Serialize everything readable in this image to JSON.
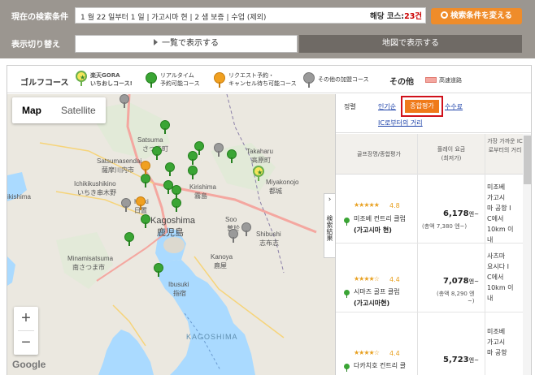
{
  "search": {
    "label": "現在の検索条件",
    "conditions": "1 월 22 일부터 1 일 | 가고시마 현 | 2 샘 보증 | 수업 (제외)",
    "hit_prefix": "해당 코스:",
    "hit_count": "23건",
    "change_button": "検索条件を変える"
  },
  "display": {
    "label": "表示切り替え",
    "list_button": "一覧で表示する",
    "map_button": "地図で表示する"
  },
  "legend": {
    "title": "ゴルフコース",
    "gora": "楽天GORA\nいちおしコース!",
    "realtime": "リアルタイム\n予約可能コース",
    "request": "リクエスト予約・\nキャンセル待ち可能コース",
    "other": "その他の加盟コース",
    "sonota": "その他",
    "highway": "高速道路"
  },
  "map": {
    "type_map": "Map",
    "type_satellite": "Satellite",
    "zoom_in": "+",
    "zoom_out": "−",
    "attribution": "Google",
    "labels": {
      "satsuma": "Satsuma",
      "satsuma_jp": "さつま町",
      "satsumasendai": "Satsumasendai",
      "satsumasendai_jp": "薩摩川内市",
      "ichikikushikino": "Ichikikushikino",
      "ichikikushikino_jp": "いちき串木野",
      "hioki": "Hioki",
      "hioki_jp": "日置",
      "kagoshima": "Kagoshima",
      "kagoshima_jp": "鹿児島",
      "kirishima": "Kirishima",
      "kirishima_jp": "霧島",
      "takaharu": "Takaharu",
      "takaharu_jp": "高原町",
      "miyakonojo": "Miyakonojo",
      "miyakonojo_jp": "都城",
      "soo": "Soo",
      "soo_jp": "曽於",
      "shibushi": "Shibushi",
      "shibushi_jp": "志布志",
      "kanoya": "Kanoya",
      "kanoya_jp": "鹿屋",
      "minamisatsuma": "Minamisatsuma",
      "minamisatsuma_jp": "南さつま市",
      "ibusuki": "Ibusuki",
      "ibusuki_jp": "指宿",
      "kagoshima_bay": "KAGOSHIMA",
      "kirishima_en": "Kirishima",
      "ebino": "Ebino",
      "hitoyoshi": "市",
      "left_edge": "ikishima"
    },
    "side_tab": "検索結果"
  },
  "panel": {
    "sort_label": "정렬",
    "sort_popular": "인기순",
    "sort_overall": "종합평가",
    "sort_fee": "수수료",
    "sort_ic": "IC로부터의 거리",
    "th_name": "골프장명/종합평가",
    "th_fee": "플레이 요금\n(최저가)",
    "th_dist": "가장 가까운 IC\n로부터의 거리",
    "courses": [
      {
        "stars": "★★★★★",
        "rating": "4.8",
        "name": "미조베 컨트리 클럽",
        "pref": "(가고시마 현)",
        "price": "6,178",
        "price_unit": "엔~",
        "tax": "(총액 7,380 엔~)",
        "distance": "미조베\n가고시\n마 공항 I\nC에서\n10km 이\n내"
      },
      {
        "stars": "★★★★☆",
        "rating": "4.4",
        "name": "시마즈 골프 클럽",
        "pref": "(가고시마현)",
        "price": "7,078",
        "price_unit": "엔~",
        "tax": "(총액 8,290 엔\n~)",
        "distance": "사츠마\n요시다 I\nC에서\n10km 이\n내"
      },
      {
        "stars": "★★★★☆",
        "rating": "4.4",
        "name": "다카치호 컨트리 클",
        "pref": "",
        "price": "5,723",
        "price_unit": "엔~",
        "tax": "",
        "distance": "미조베\n가고시\n마 공항"
      }
    ]
  },
  "colors": {
    "topbar": "#9b9690",
    "orange_accent": "#ef8c2a",
    "green_pin": "#3aa534",
    "orange_pin": "#f0a020",
    "gray_pin": "#9a9a9a",
    "highlight_border": "#d0101a"
  }
}
